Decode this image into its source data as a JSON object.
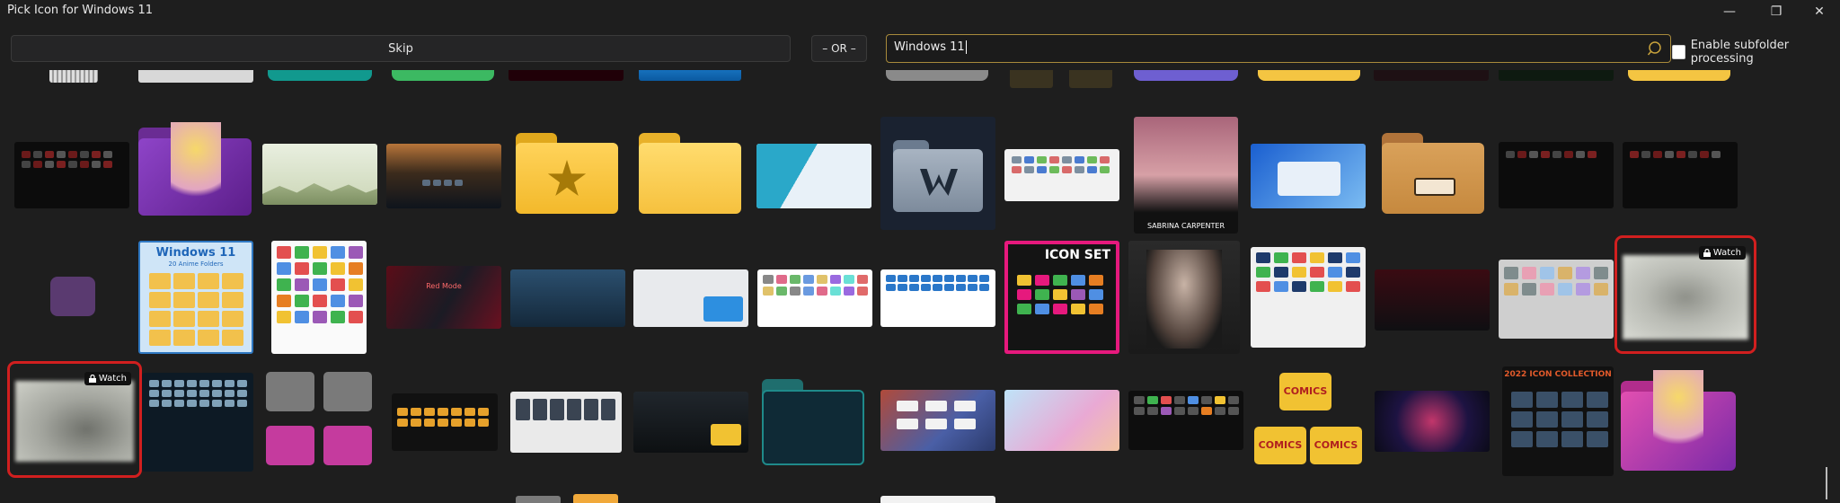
{
  "window": {
    "title": "Pick Icon for Windows 11",
    "controls": {
      "minimize": "—",
      "maximize": "❐",
      "close": "✕"
    }
  },
  "toolbar": {
    "skip_label": "Skip",
    "or_label": "– OR –",
    "search_value": "Windows 11",
    "search_icon": "search-icon",
    "subfolder_label": "Enable subfolder processing",
    "subfolder_checked": false
  },
  "grid": {
    "watch_label": "Watch",
    "tile_texts": {
      "windows11_title": "Windows 11",
      "windows11_sub": "20 Anime Folders",
      "red_mode": "Red Mode",
      "sabrina": "SABRINA CARPENTER",
      "icon_set": "ICON SET",
      "comics": "COMICS",
      "collection_2022": "2022 ICON COLLECTION"
    }
  }
}
